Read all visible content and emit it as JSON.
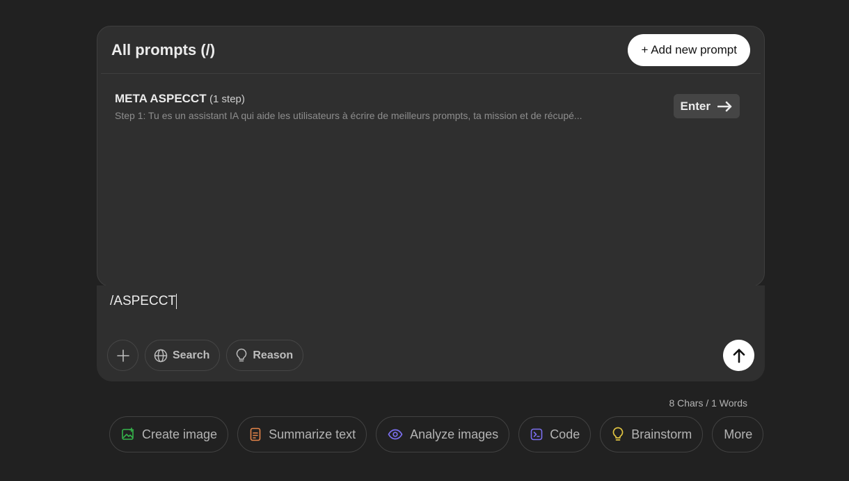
{
  "prompts_panel": {
    "title": "All prompts (/)",
    "add_button_label": "+ Add new prompt",
    "items": [
      {
        "name": "META ASPECCT",
        "steps": "(1 step)",
        "description": "Step 1: Tu es un assistant IA qui aide les utilisateurs à écrire de meilleurs prompts, ta mission et de récupé...",
        "enter_label": "Enter"
      }
    ]
  },
  "composer": {
    "value": "/ASPECCT",
    "tools": [
      {
        "label": "Search",
        "icon": "globe-icon"
      },
      {
        "label": "Reason",
        "icon": "lightbulb-icon"
      }
    ]
  },
  "counter": "8 Chars / 1 Words",
  "suggestions": [
    {
      "label": "Create image",
      "icon": "image-icon",
      "color": "#35b34a"
    },
    {
      "label": "Summarize text",
      "icon": "document-icon",
      "color": "#e8864a"
    },
    {
      "label": "Analyze images",
      "icon": "eye-icon",
      "color": "#7b6ff0"
    },
    {
      "label": "Code",
      "icon": "terminal-icon",
      "color": "#7b6ff0"
    },
    {
      "label": "Brainstorm",
      "icon": "lightbulb-icon",
      "color": "#e2c541"
    },
    {
      "label": "More",
      "icon": "",
      "color": ""
    }
  ]
}
